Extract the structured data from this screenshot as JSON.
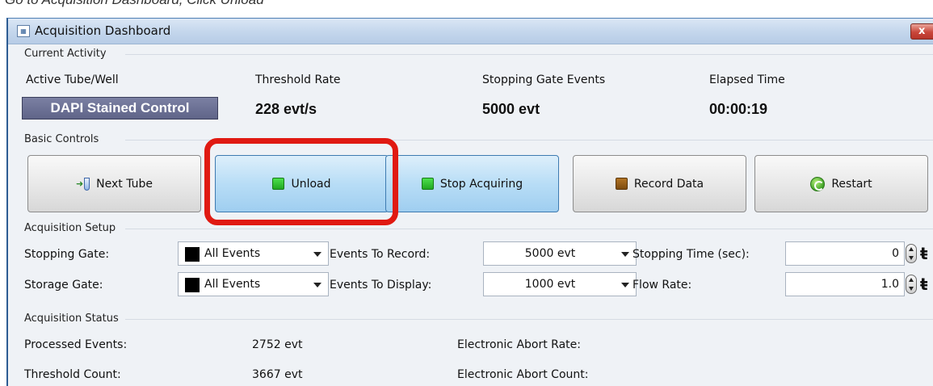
{
  "instruction": "Go to Acquisition Dashboard, Click Unload",
  "window": {
    "title": "Acquisition Dashboard",
    "close_label": "x"
  },
  "current_activity": {
    "section_label": "Current Activity",
    "headers": {
      "tube": "Active Tube/Well",
      "threshold": "Threshold Rate",
      "stopping": "Stopping Gate Events",
      "elapsed": "Elapsed Time"
    },
    "values": {
      "tube": "DAPI Stained Control",
      "threshold": "228 evt/s",
      "stopping": "5000 evt",
      "elapsed": "00:00:19"
    }
  },
  "basic_controls": {
    "section_label": "Basic Controls",
    "buttons": {
      "next_tube": "Next Tube",
      "unload": "Unload",
      "stop_acquiring": "Stop Acquiring",
      "record_data": "Record Data",
      "restart": "Restart"
    }
  },
  "acquisition_setup": {
    "section_label": "Acquisition Setup",
    "stopping_gate": {
      "label": "Stopping Gate:",
      "value": "All Events"
    },
    "storage_gate": {
      "label": "Storage Gate:",
      "value": "All Events"
    },
    "events_to_record": {
      "label": "Events To Record:",
      "value": "5000 evt"
    },
    "events_to_display": {
      "label": "Events To Display:",
      "value": "1000 evt"
    },
    "stopping_time": {
      "label": "Stopping Time (sec):",
      "value": "0"
    },
    "flow_rate": {
      "label": "Flow Rate:",
      "value": "1.0"
    }
  },
  "acquisition_status": {
    "section_label": "Acquisition Status",
    "processed_events": {
      "label": "Processed Events:",
      "value": "2752 evt"
    },
    "threshold_count": {
      "label": "Threshold Count:",
      "value": "3667 evt"
    },
    "electronic_abort_rate": {
      "label": "Electronic Abort Rate:"
    },
    "electronic_abort_count": {
      "label": "Electronic Abort Count:"
    }
  },
  "colors": {
    "highlight": "#e01a12",
    "active_button": "#b8ddf6",
    "tube_box": "#6b7094"
  },
  "icons": [
    "app-icon",
    "close-icon",
    "next-tube-icon",
    "green-square-icon",
    "brown-square-icon",
    "restart-icon",
    "chevron-down-icon",
    "spinner-icon",
    "pin-icon"
  ]
}
